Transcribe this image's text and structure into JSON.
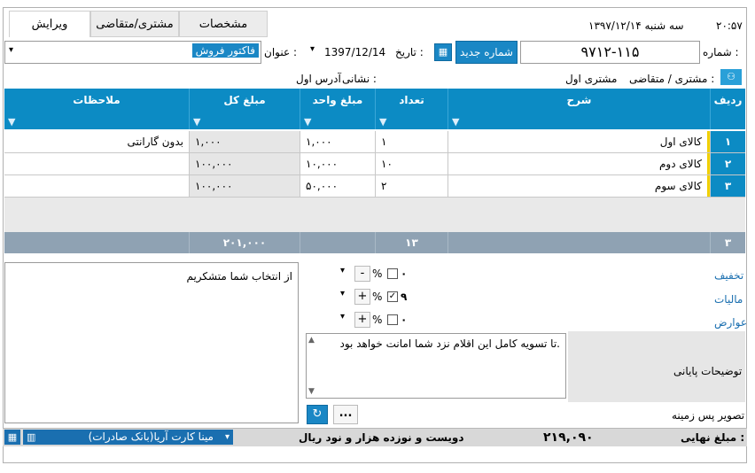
{
  "header": {
    "time": "۲۰:۵۷",
    "date_text": "سه شنبه ۱۳۹۷/۱۲/۱۴"
  },
  "tabs": [
    {
      "label": "ویرایش"
    },
    {
      "label": "مشتری/متقاضی"
    },
    {
      "label": "مشخصات"
    }
  ],
  "form": {
    "number_label": "شماره :",
    "number_value": "۹۷۱۲-۱۱۵",
    "new_number_button": "شماره جدید",
    "date_label": "تاریخ :",
    "date_value": "1397/12/14",
    "title_label": "عنوان :",
    "title_value": "فاکتور فروش",
    "customer_label": "مشتری / متقاضی :",
    "customer_value": "مشتری اول",
    "address_label": "نشانی :",
    "address_value": "آدرس اول"
  },
  "grid": {
    "columns": [
      "ردیف",
      "شرح",
      "تعداد",
      "مبلغ واحد",
      "مبلغ کل",
      "ملاحظات"
    ],
    "rows": [
      {
        "index": "۱",
        "desc": "کالای اول",
        "qty": "۱",
        "unit": "۱,۰۰۰",
        "total": "۱,۰۰۰",
        "note": "بدون گارانتی"
      },
      {
        "index": "۲",
        "desc": "کالای دوم",
        "qty": "۱۰",
        "unit": "۱۰,۰۰۰",
        "total": "۱۰۰,۰۰۰",
        "note": ""
      },
      {
        "index": "۳",
        "desc": "کالای سوم",
        "qty": "۲",
        "unit": "۵۰,۰۰۰",
        "total": "۱۰۰,۰۰۰",
        "note": ""
      }
    ],
    "footer": {
      "count": "۳",
      "qty_sum": "۱۳",
      "total_sum": "۲۰۱,۰۰۰"
    }
  },
  "notes": {
    "left_text": "از انتخاب شما متشکریم"
  },
  "adjustments": {
    "discount_label": "تخفیف",
    "discount_value": "۰",
    "tax_label": "مالیات",
    "tax_value": "۹",
    "fees_label": "عوارض",
    "fees_value": "۰",
    "percent_symbol": "%",
    "minus_symbol": "-",
    "plus_symbol": "+"
  },
  "final": {
    "description_label": "توضیحات پایانی",
    "description_text": "تا تسویه کامل این اقلام نزد شما امانت خواهد بود.",
    "background_label": "تصویر پس زمینه",
    "more_button": "...",
    "refresh_button": "↻",
    "total_label": "مبلغ نهایی :",
    "total_value": "۲۱۹,۰۹۰",
    "total_words": "دویست و نوزده هزار و نود ریال",
    "bank_value": "مینا کارت آریا(بانک صادرات)"
  },
  "colors": {
    "accent": "#0c8bc4",
    "footer_gray": "#8fa2b3"
  }
}
